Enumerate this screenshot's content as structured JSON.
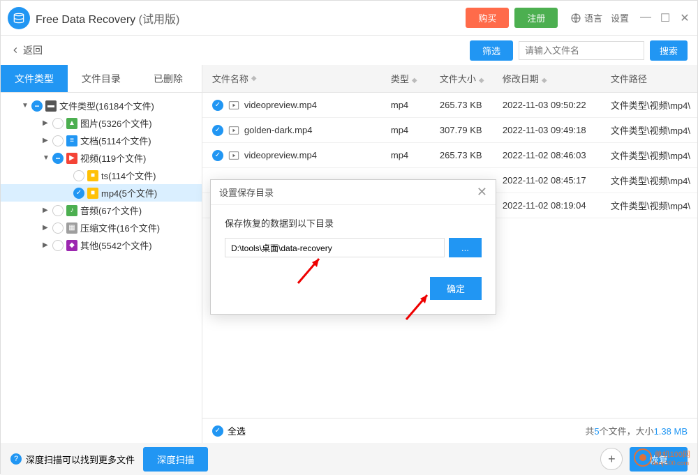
{
  "titlebar": {
    "app_name": "Free Data Recovery",
    "app_sub": "(试用版)",
    "buy": "购买",
    "register": "注册",
    "language": "语言",
    "settings": "设置"
  },
  "toolbar": {
    "back": "返回",
    "filter": "筛选",
    "search_placeholder": "请输入文件名",
    "search": "搜索"
  },
  "side_tabs": {
    "type": "文件类型",
    "dir": "文件目录",
    "deleted": "已删除"
  },
  "tree": {
    "root": "文件类型(16184个文件)",
    "pic": "图片(5326个文件)",
    "doc": "文档(5114个文件)",
    "vid": "视频(119个文件)",
    "ts": "ts(114个文件)",
    "mp4": "mp4(5个文件)",
    "aud": "音频(67个文件)",
    "zip": "压缩文件(16个文件)",
    "other": "其他(5542个文件)"
  },
  "columns": {
    "name": "文件名称",
    "type": "类型",
    "size": "文件大小",
    "date": "修改日期",
    "path": "文件路径"
  },
  "rows": [
    {
      "name": "videopreview.mp4",
      "type": "mp4",
      "size": "265.73 KB",
      "date": "2022-11-03 09:50:22",
      "path": "文件类型\\视频\\mp4\\"
    },
    {
      "name": "golden-dark.mp4",
      "type": "mp4",
      "size": "307.79 KB",
      "date": "2022-11-03 09:49:18",
      "path": "文件类型\\视频\\mp4\\"
    },
    {
      "name": "videopreview.mp4",
      "type": "mp4",
      "size": "265.73 KB",
      "date": "2022-11-02 08:46:03",
      "path": "文件类型\\视频\\mp4\\"
    },
    {
      "name": "",
      "type": "",
      "size": "",
      "date": "2022-11-02 08:45:17",
      "path": "文件类型\\视频\\mp4\\"
    },
    {
      "name": "",
      "type": "",
      "size": "",
      "date": "2022-11-02 08:19:04",
      "path": "文件类型\\视频\\mp4\\"
    }
  ],
  "status": {
    "select_all": "全选",
    "summary_prefix": "共",
    "count": "5",
    "summary_mid": "个文件，大小",
    "total_size": "1.38 MB"
  },
  "bottom": {
    "tip": "深度扫描可以找到更多文件",
    "deep_scan": "深度扫描",
    "recover": "恢复"
  },
  "dialog": {
    "title": "设置保存目录",
    "label": "保存恢复的数据到以下目录",
    "path": "D:\\tools\\桌面\\data-recovery",
    "browse": "...",
    "ok": "确定"
  },
  "watermark": {
    "name": "单机100网",
    "url": "danji100.com"
  }
}
